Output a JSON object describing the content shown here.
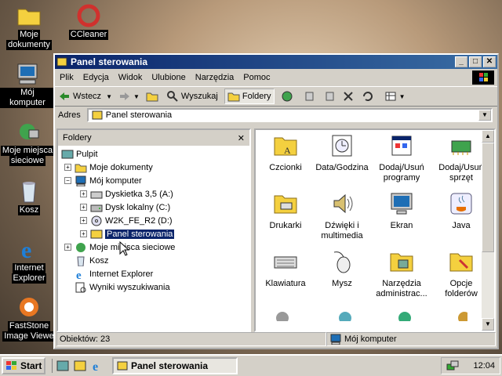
{
  "desktop": {
    "icons": [
      {
        "label": "Moje dokumenty",
        "icon": "folder-icon"
      },
      {
        "label": "CCleaner",
        "icon": "ccleaner-icon"
      },
      {
        "label": "Mój komputer",
        "icon": "computer-icon"
      },
      {
        "label": "Moje miejsca sieciowe",
        "icon": "network-icon"
      },
      {
        "label": "Kosz",
        "icon": "recycle-bin-icon"
      },
      {
        "label": "Internet Explorer",
        "icon": "ie-icon"
      },
      {
        "label": "FastStone Image Viewer",
        "icon": "faststone-icon"
      }
    ],
    "labels": [
      "Moje",
      "dokumenty",
      "CCleaner",
      "Mój komputer",
      "Moje miejsca",
      "sieciowe",
      "Kosz",
      "Internet",
      "Explorer",
      "FastStone",
      "Image Viewe"
    ]
  },
  "window": {
    "title": "Panel sterowania",
    "menu": [
      "Plik",
      "Edycja",
      "Widok",
      "Ulubione",
      "Narzędzia",
      "Pomoc"
    ],
    "toolbar": {
      "back": "Wstecz",
      "search": "Wyszukaj",
      "folders": "Foldery"
    },
    "address_label": "Adres",
    "address_value": "Panel sterowania",
    "folders_header": "Foldery",
    "tree": [
      "Pulpit",
      "Moje dokumenty",
      "Mój komputer",
      "Dyskietka 3,5 (A:)",
      "Dysk lokalny (C:)",
      "W2K_FE_R2 (D:)",
      "Panel sterowania",
      "Moje miejsca sieciowe",
      "Kosz",
      "Internet Explorer",
      "Wyniki wyszukiwania"
    ],
    "items": [
      [
        "Czcionki",
        ""
      ],
      [
        "Data/Godzina",
        ""
      ],
      [
        "Dodaj/Usuń",
        "programy"
      ],
      [
        "Dodaj/Usuń",
        "sprzęt"
      ],
      [
        "Drukarki",
        ""
      ],
      [
        "Dźwięki i",
        "multimedia"
      ],
      [
        "Ekran",
        ""
      ],
      [
        "Java",
        ""
      ],
      [
        "Klawiatura",
        ""
      ],
      [
        "Mysz",
        ""
      ],
      [
        "Narzędzia",
        "administrac..."
      ],
      [
        "Opcje",
        "folderów"
      ]
    ],
    "status_left": "Obiektów: 23",
    "status_right": "Mój komputer"
  },
  "taskbar": {
    "start": "Start",
    "task": "Panel sterowania",
    "clock": "12:04"
  }
}
